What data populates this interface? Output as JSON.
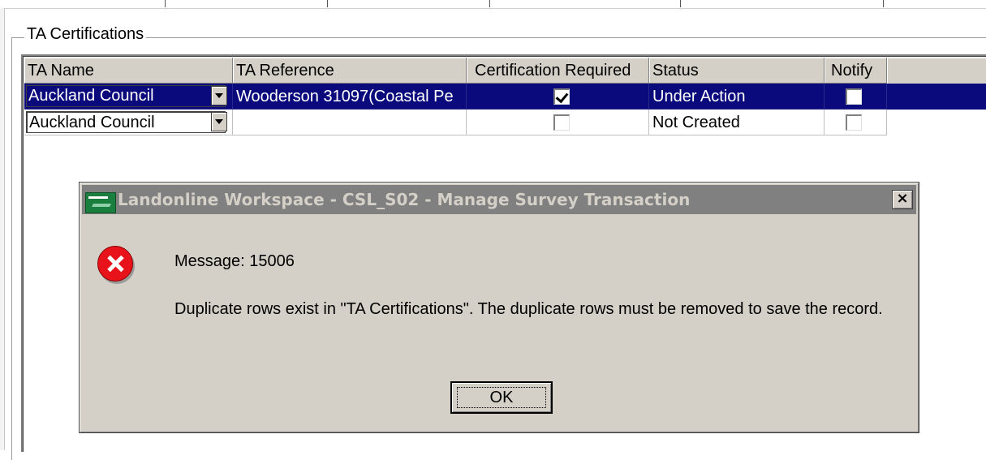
{
  "group": {
    "title": "TA Certifications"
  },
  "grid": {
    "columns": [
      "TA Name",
      "TA Reference",
      "Certification Required",
      "Status",
      "Notify"
    ],
    "rows": [
      {
        "ta_name": "Auckland Council",
        "ta_reference": "Wooderson 31097(Coastal Pe",
        "certification_required": true,
        "status": "Under Action",
        "notify": false
      },
      {
        "ta_name": "Auckland Council",
        "ta_reference": "",
        "certification_required": false,
        "status": "Not Created",
        "notify": false
      }
    ]
  },
  "dialog": {
    "title": "Landonline Workspace - CSL_S02 - Manage Survey Transaction",
    "close_label": "×",
    "message_code": "Message: 15006",
    "message_body": "Duplicate rows exist in \"TA Certifications\". The duplicate rows must be removed to save the record.",
    "ok_label": "OK"
  },
  "colors": {
    "selection": "#0a0a7d",
    "titlebar_inactive": "#808080",
    "dialog_face": "#d4d0c8",
    "error_red": "#e8131a"
  }
}
